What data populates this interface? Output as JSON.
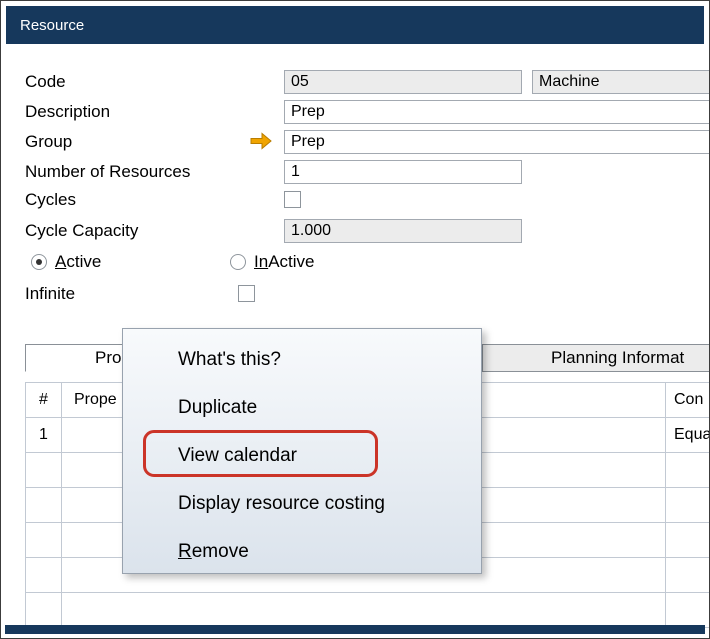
{
  "title_bar": {
    "title": "Resource"
  },
  "form": {
    "code_label": "Code",
    "code_value": "05",
    "type_value": "Machine",
    "description_label": "Description",
    "description_value": "Prep",
    "group_label": "Group",
    "group_value": "Prep",
    "num_label": "Number of Resources",
    "num_value": "1",
    "cycles_label": "Cycles",
    "cycle_capacity_label": "Cycle Capacity",
    "cycle_capacity_value": "1.000",
    "active_u": "A",
    "active_rest": "ctive",
    "inactive_u": "In",
    "inactive_rest": "Active",
    "infinite_label": "Infinite"
  },
  "tabs": {
    "tab1": "Pro",
    "tab2": "Planning Informat"
  },
  "table": {
    "headers": {
      "num": "#",
      "properties": "Prope",
      "third": "Con"
    },
    "row1": {
      "num": "1",
      "third": "Equa"
    }
  },
  "menu": {
    "items": [
      {
        "pre": "What's this?",
        "u": "",
        "rest": ""
      },
      {
        "pre": "Duplicate",
        "u": "",
        "rest": ""
      },
      {
        "pre": "View calendar",
        "u": "",
        "rest": ""
      },
      {
        "pre": "Display resource costing",
        "u": "",
        "rest": ""
      },
      {
        "pre": "",
        "u": "R",
        "rest": "emove"
      }
    ]
  },
  "colors": {
    "titlebar_navy": "#16385c",
    "annotation_red": "#cb3428",
    "link_arrow_orange": "#f0a400"
  }
}
